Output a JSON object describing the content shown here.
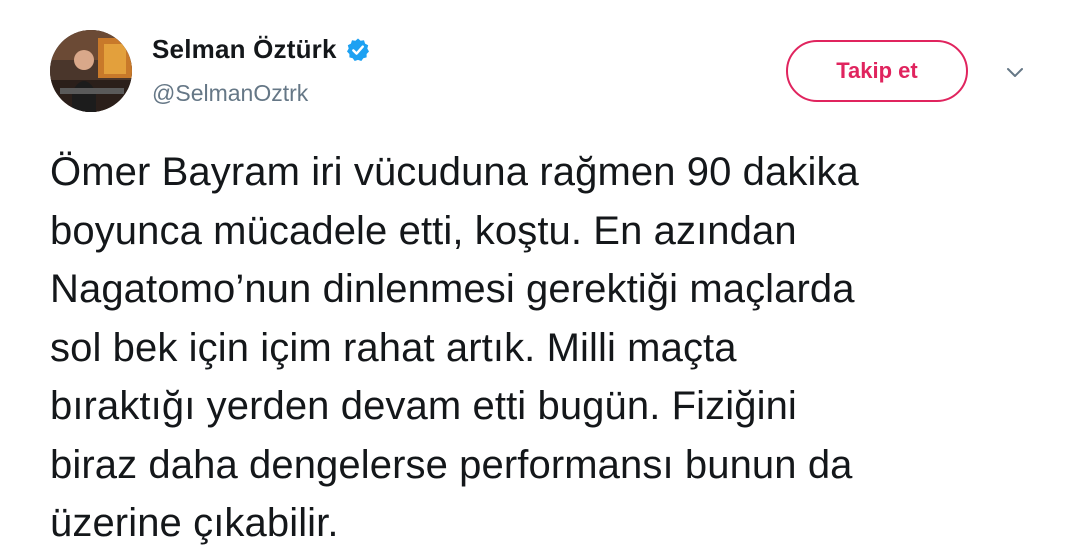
{
  "user": {
    "display_name": "Selman Öztürk",
    "handle": "@SelmanOztrk",
    "verified": true,
    "avatar_icon": "profile-photo"
  },
  "actions": {
    "follow_label": "Takip et",
    "menu_icon": "chevron-down-icon"
  },
  "tweet": {
    "text": "Ömer Bayram iri vücuduna rağmen 90 dakika\nboyunca mücadele etti, koştu. En azından\nNagatomo’nun dinlenmesi gerektiği maçlarda\nsol bek için içim rahat artık. Milli maçta\nbıraktığı yerden devam etti bugün. Fiziğini\nbiraz daha dengelerse performansı bunun da\nüzerine çıkabilir."
  },
  "colors": {
    "accent_follow": "#e0245e",
    "verified_blue": "#1da1f2",
    "handle_gray": "#657786",
    "text": "#14171a"
  }
}
